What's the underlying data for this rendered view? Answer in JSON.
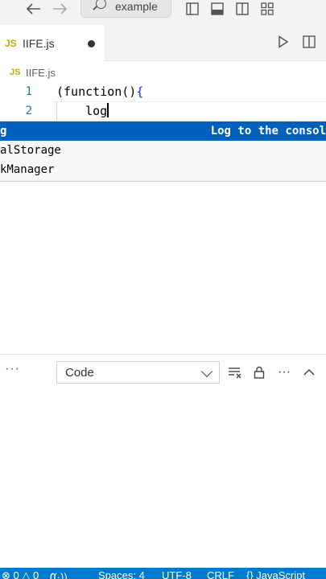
{
  "titlebar": {
    "search_text": "example",
    "icons": [
      "back-arrow-icon",
      "forward-arrow-icon",
      "search-icon",
      "toggle-sidebar-icon",
      "toggle-panel-icon",
      "toggle-secondary-sidebar-icon",
      "customize-layout-icon"
    ]
  },
  "tab": {
    "badge": "JS",
    "label": "IIFE.js"
  },
  "breadcrumb": {
    "badge": "JS",
    "file": "IIFE.js"
  },
  "editor": {
    "lines": [
      {
        "number": "1",
        "code": "(function()"
      },
      {
        "number": "2",
        "code": "    log"
      }
    ],
    "brace": "{"
  },
  "suggest": {
    "selected_label": "g",
    "selected_detail": "Log to the consol",
    "items": [
      {
        "pre": "",
        "hl": "",
        "text": "alStorage"
      },
      {
        "pre": "",
        "hl": "",
        "text": "kManager"
      }
    ]
  },
  "panel": {
    "select_value": "Code",
    "ellipsis": "···"
  },
  "statusbar": {
    "problems": "⊗ 0 △ 0",
    "ports": "0",
    "spaces": "Spaces: 4",
    "encoding": "UTF-8",
    "eol": "CRLF",
    "language": "{} JavaScript"
  },
  "colors": {
    "accent": "#007acc",
    "selection": "#0060c0",
    "js_badge": "#cba600"
  }
}
